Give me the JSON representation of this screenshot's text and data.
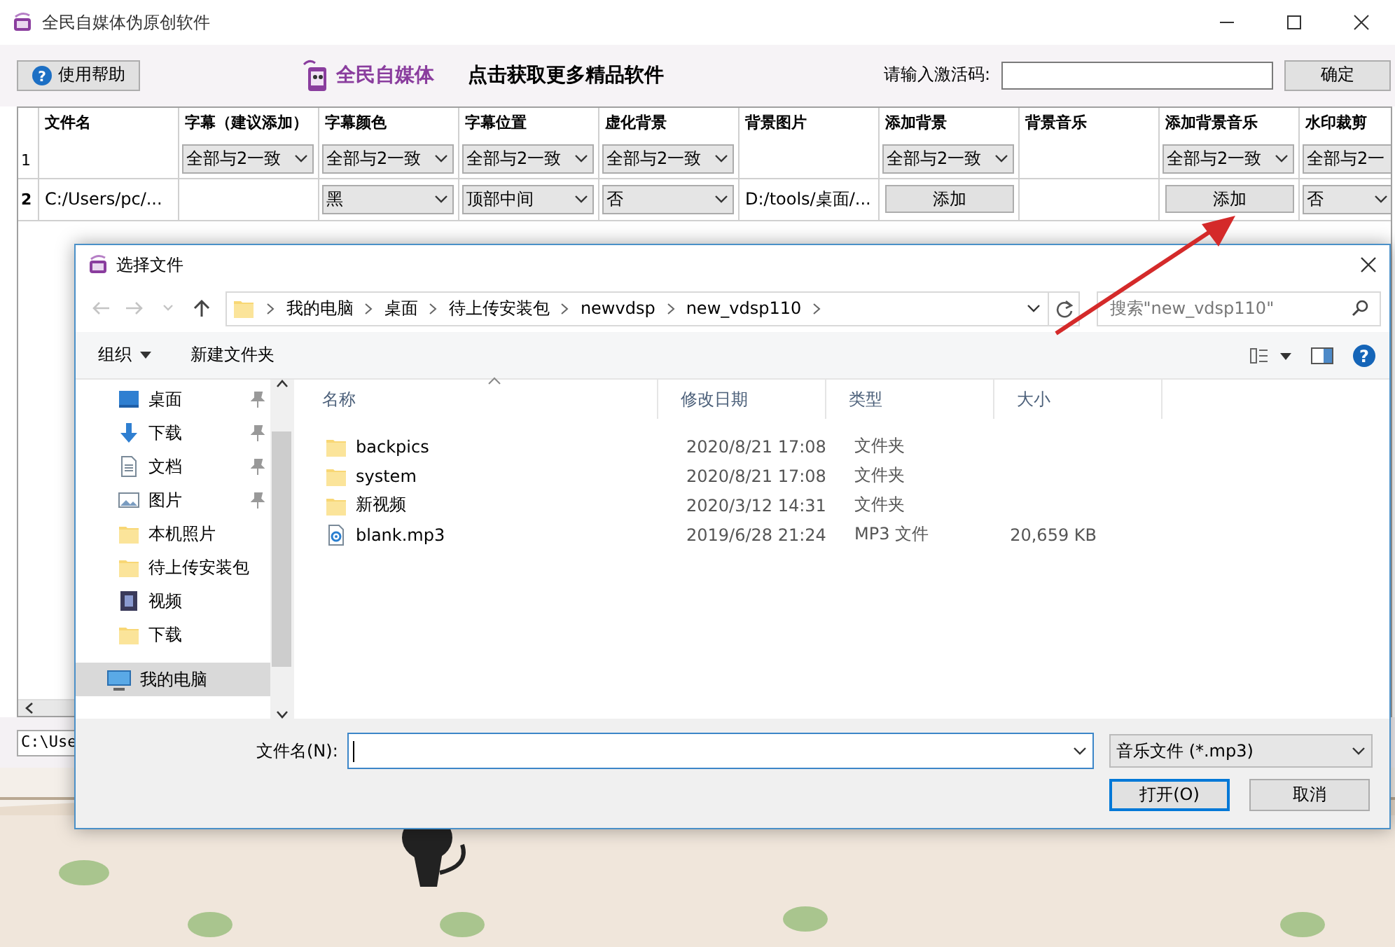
{
  "window": {
    "title": "全民自媒体伪原创软件"
  },
  "toolbar": {
    "help_glyph": "?",
    "help_button": "使用帮助",
    "brand": "全民自媒体",
    "promo": "点击获取更多精品软件",
    "activation_label": "请输入激活码:",
    "confirm_button": "确定"
  },
  "table": {
    "filter_row_number": "1",
    "columns": [
      {
        "title": "文件名"
      },
      {
        "title": "字幕（建议添加）",
        "filter": "全部与2一致"
      },
      {
        "title": "字幕颜色",
        "filter": "全部与2一致"
      },
      {
        "title": "字幕位置",
        "filter": "全部与2一致"
      },
      {
        "title": "虚化背景",
        "filter": "全部与2一致"
      },
      {
        "title": "背景图片"
      },
      {
        "title": "添加背景",
        "filter": "全部与2一致"
      },
      {
        "title": "背景音乐"
      },
      {
        "title": "添加背景音乐",
        "filter": "全部与2一致"
      },
      {
        "title": "水印裁剪",
        "filter": "全部与2一"
      }
    ],
    "rows": [
      {
        "number": "2",
        "cells": [
          {
            "kind": "text",
            "text": "C:/Users/pc/..."
          },
          {
            "kind": "blank"
          },
          {
            "kind": "select",
            "text": "黑"
          },
          {
            "kind": "select",
            "text": "顶部中间"
          },
          {
            "kind": "select",
            "text": "否"
          },
          {
            "kind": "text",
            "text": "D:/tools/桌面/..."
          },
          {
            "kind": "button",
            "text": "添加"
          },
          {
            "kind": "blank"
          },
          {
            "kind": "button",
            "text": "添加"
          },
          {
            "kind": "select",
            "text": "否"
          }
        ]
      }
    ]
  },
  "path_field": {
    "value": "C:\\Use"
  },
  "dialog": {
    "title": "选择文件",
    "breadcrumbs": [
      "我的电脑",
      "桌面",
      "待上传安装包",
      "newvdsp",
      "new_vdsp110"
    ],
    "search_placeholder": "搜索\"new_vdsp110\"",
    "organize": "组织",
    "new_folder": "新建文件夹",
    "help_glyph": "?",
    "nav": [
      {
        "label": "桌面",
        "kind": "desktop",
        "pinned": true,
        "selected": false
      },
      {
        "label": "下载",
        "kind": "download",
        "pinned": true,
        "selected": false
      },
      {
        "label": "文档",
        "kind": "document",
        "pinned": true,
        "selected": false
      },
      {
        "label": "图片",
        "kind": "pictures",
        "pinned": true,
        "selected": false
      },
      {
        "label": "本机照片",
        "kind": "folder",
        "pinned": false,
        "selected": false
      },
      {
        "label": "待上传安装包",
        "kind": "folder",
        "pinned": false,
        "selected": false
      },
      {
        "label": "视频",
        "kind": "video",
        "pinned": false,
        "selected": false
      },
      {
        "label": "下载",
        "kind": "folder",
        "pinned": false,
        "selected": false
      },
      {
        "label": "我的电脑",
        "kind": "computer",
        "pinned": false,
        "selected": true
      }
    ],
    "columns": [
      "名称",
      "修改日期",
      "类型",
      "大小"
    ],
    "files": [
      {
        "name": "backpics",
        "kind": "folder",
        "modified": "2020/8/21 17:08",
        "type": "文件夹"
      },
      {
        "name": "system",
        "kind": "folder",
        "modified": "2020/8/21 17:08",
        "type": "文件夹"
      },
      {
        "name": "新视频",
        "kind": "folder",
        "modified": "2020/3/12 14:31",
        "type": "文件夹"
      },
      {
        "name": "blank.mp3",
        "kind": "audio",
        "modified": "2019/6/28 21:24",
        "type": "MP3 文件",
        "size": "20,659 KB"
      }
    ],
    "filename_label": "文件名(N):",
    "file_type": "音乐文件 (*.mp3)",
    "buttons": [
      {
        "label": "打开(O)",
        "default": true
      },
      {
        "label": "取消",
        "default": false
      }
    ]
  }
}
